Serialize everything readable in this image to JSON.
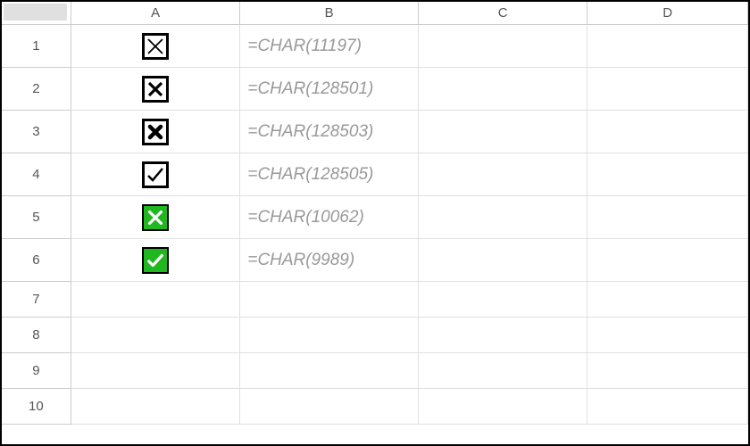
{
  "columns": {
    "A": "A",
    "B": "B",
    "C": "C",
    "D": "D"
  },
  "row_labels": {
    "1": "1",
    "2": "2",
    "3": "3",
    "4": "4",
    "5": "5",
    "6": "6",
    "7": "7",
    "8": "8",
    "9": "9",
    "10": "10"
  },
  "cells": {
    "A1_symbol": "xbox-thin",
    "B1": "=CHAR(11197)",
    "A2_symbol": "xbox-bold",
    "B2": "=CHAR(128501)",
    "A3_symbol": "xbox-heavy",
    "B3": "=CHAR(128503)",
    "A4_symbol": "checkbox",
    "B4": "=CHAR(128505)",
    "A5_symbol": "green-x",
    "B5": "=CHAR(10062)",
    "A6_symbol": "green-check",
    "B6": "=CHAR(9989)"
  }
}
